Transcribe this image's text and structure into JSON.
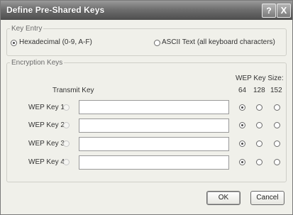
{
  "dialog": {
    "title": "Define Pre-Shared Keys",
    "help_icon": "?",
    "close_icon": "X"
  },
  "key_entry": {
    "legend": "Key Entry",
    "options": [
      {
        "label": "Hexadecimal (0-9, A-F)",
        "selected": true
      },
      {
        "label": "ASCII Text (all keyboard characters)",
        "selected": false
      }
    ]
  },
  "encryption_keys": {
    "legend": "Encryption Keys",
    "transmit_key_header": "Transmit Key",
    "wep_key_size_header": "WEP Key Size:",
    "sizes": [
      "64",
      "128",
      "152"
    ],
    "keys": [
      {
        "label": "WEP Key 1:",
        "value": "",
        "size": "64"
      },
      {
        "label": "WEP Key 2:",
        "value": "",
        "size": "64"
      },
      {
        "label": "WEP Key 3:",
        "value": "",
        "size": "64"
      },
      {
        "label": "WEP Key 4:",
        "value": "",
        "size": "64"
      }
    ]
  },
  "buttons": {
    "ok": "OK",
    "cancel": "Cancel"
  }
}
